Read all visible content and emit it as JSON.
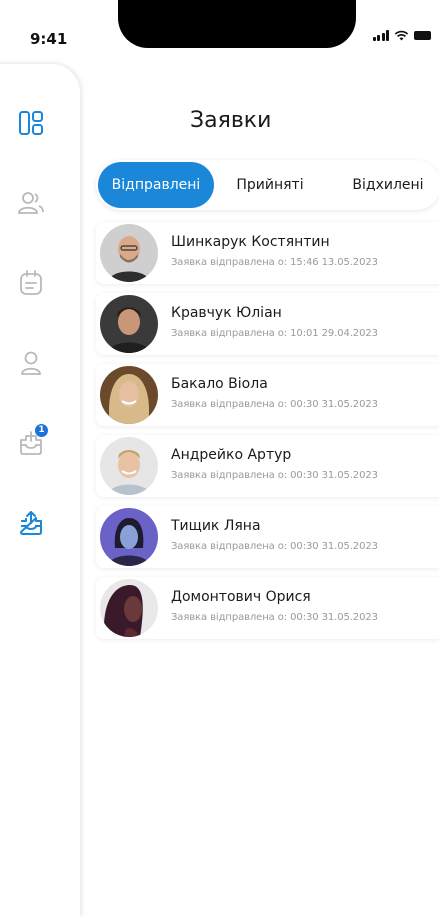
{
  "status": {
    "time": "9:41"
  },
  "title": "Заявки",
  "tabs": [
    {
      "label": "Відправлені",
      "active": true
    },
    {
      "label": "Прийняті",
      "active": false
    },
    {
      "label": "Відхилені",
      "active": false
    }
  ],
  "sidebar": {
    "items": [
      {
        "icon": "dashboard-icon",
        "active": true
      },
      {
        "icon": "users-icon",
        "active": false
      },
      {
        "icon": "calendar-icon",
        "active": false
      },
      {
        "icon": "profile-icon",
        "active": false
      },
      {
        "icon": "inbox-icon",
        "active": false,
        "badge": "1"
      },
      {
        "icon": "outbox-icon",
        "active": true
      }
    ],
    "accent": "#1a87d9",
    "inactive": "#b9b9b9"
  },
  "requests": [
    {
      "name": "Шинкарук Костянтин",
      "sent_label": "Заявка відправлена о:",
      "time": "15:46",
      "date": "13.05.2023",
      "avatar_bg": "#cfcfcf"
    },
    {
      "name": "Кравчук Юліан",
      "sent_label": "Заявка відправлена о:",
      "time": "10:01",
      "date": "29.04.2023",
      "avatar_bg": "#3a3a3a"
    },
    {
      "name": "Бакало Віола",
      "sent_label": "Заявка відправлена о:",
      "time": "00:30",
      "date": "31.05.2023",
      "avatar_bg": "#6b4a2c"
    },
    {
      "name": "Андрейко Артур",
      "sent_label": "Заявка відправлена о:",
      "time": "00:30",
      "date": "31.05.2023",
      "avatar_bg": "#e6e6e6"
    },
    {
      "name": "Тищик Ляна",
      "sent_label": "Заявка відправлена о:",
      "time": "00:30",
      "date": "31.05.2023",
      "avatar_bg": "#6a62c7"
    },
    {
      "name": "Домонтович Орися",
      "sent_label": "Заявка відправлена о:",
      "time": "00:30",
      "date": "31.05.2023",
      "avatar_bg": "#e8e8e8"
    }
  ]
}
